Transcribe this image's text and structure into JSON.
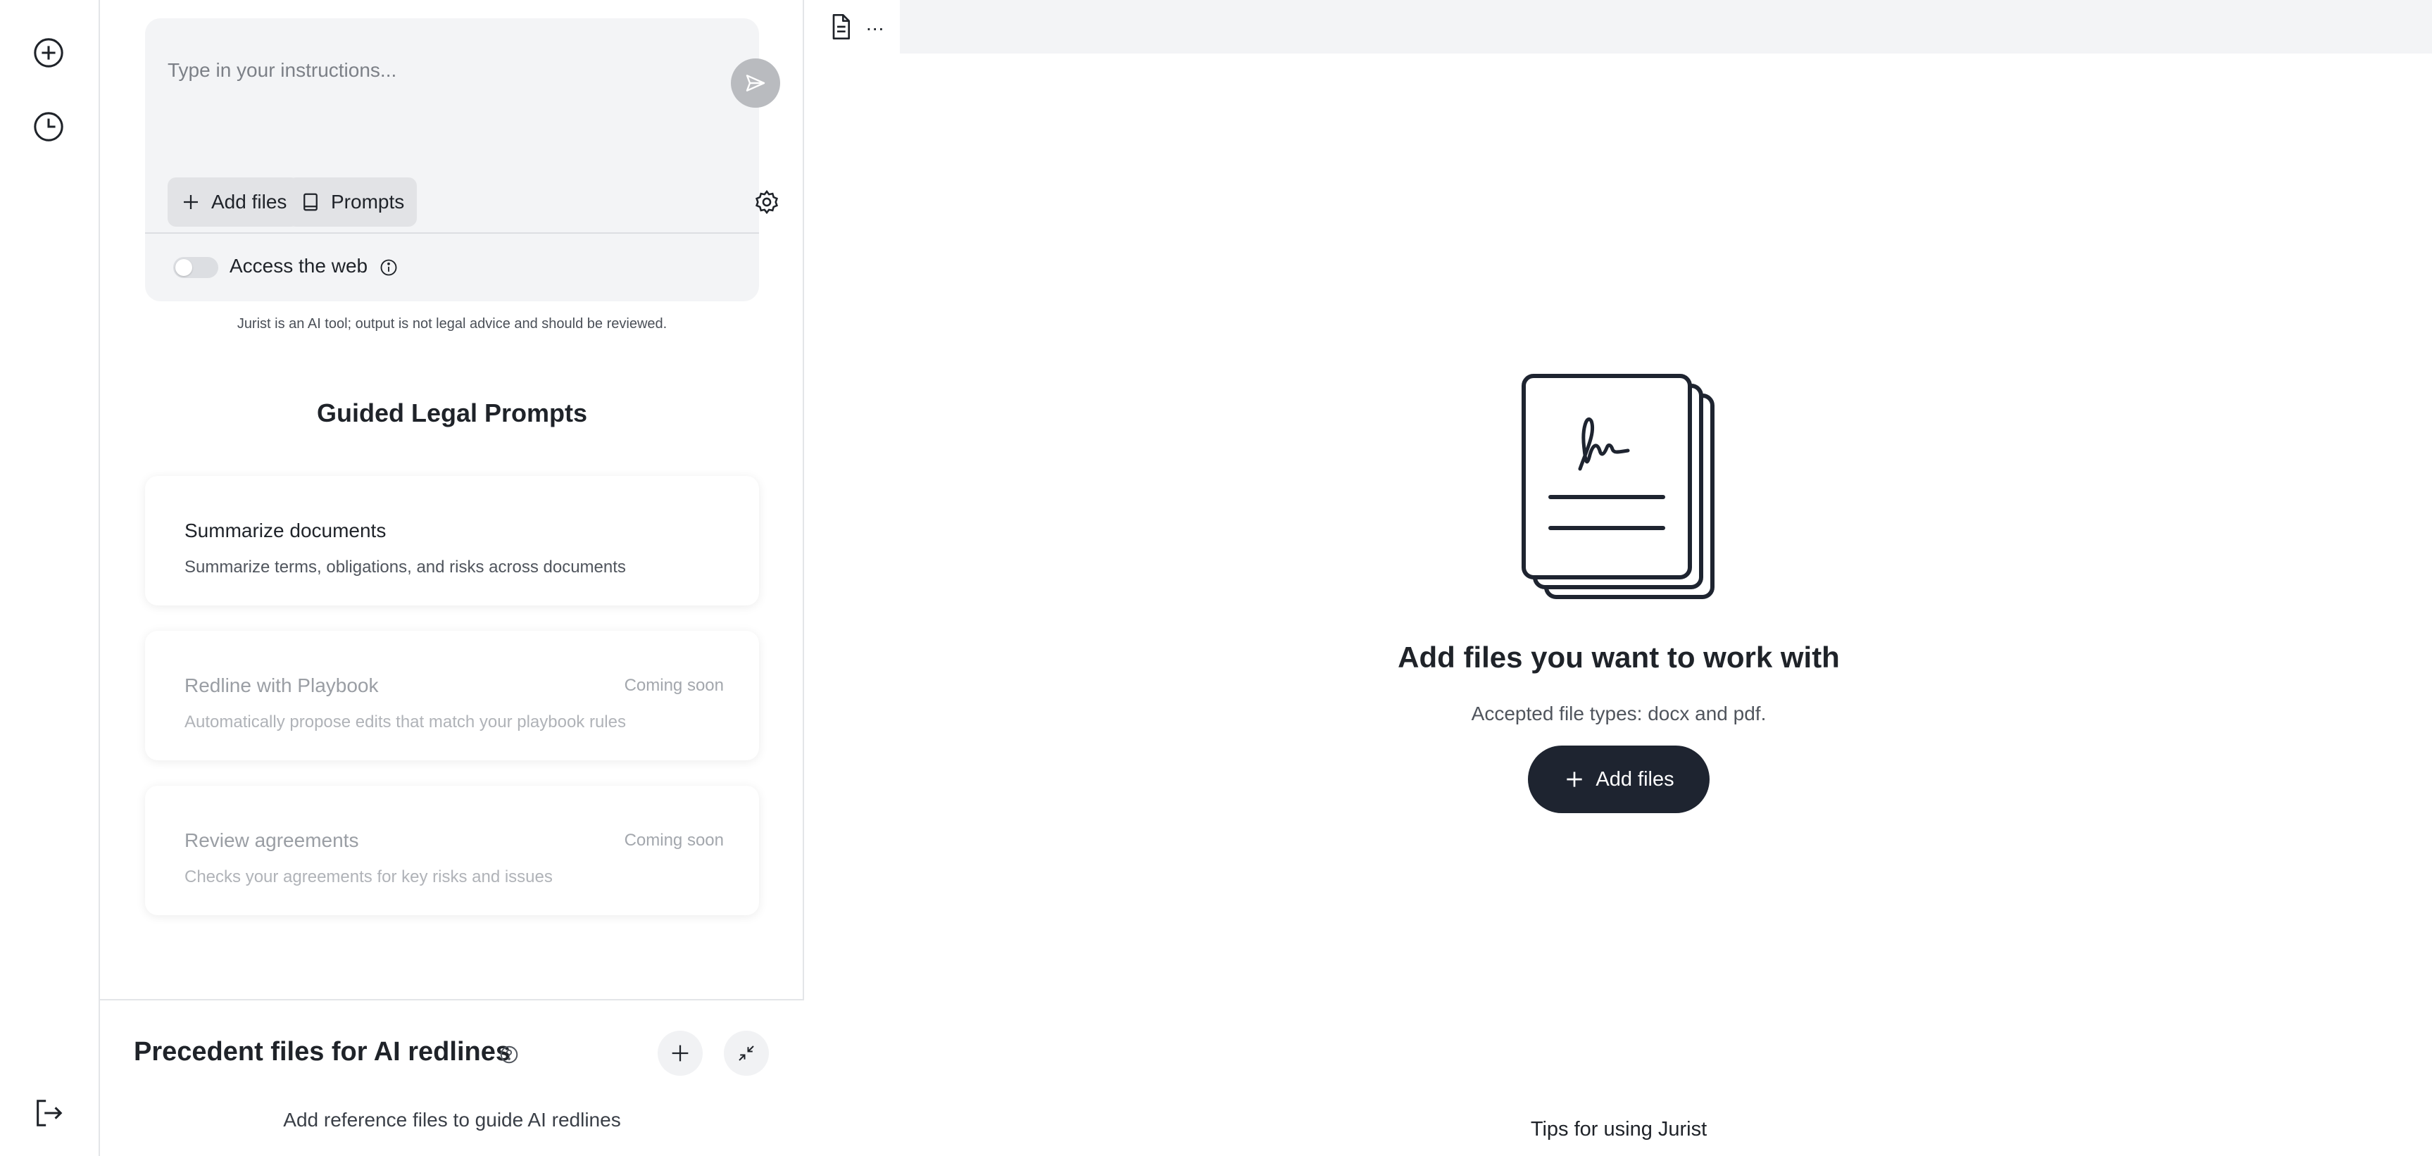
{
  "composer": {
    "placeholder": "Type in your instructions...",
    "add_files_label": "Add files",
    "prompts_label": "Prompts",
    "access_web_label": "Access the web"
  },
  "disclaimer": "Jurist is an AI tool; output is not legal advice and should be reviewed.",
  "guided": {
    "title": "Guided Legal Prompts",
    "cards": [
      {
        "title": "Summarize documents",
        "description": "Summarize terms, obligations, and risks across documents",
        "badge": ""
      },
      {
        "title": "Redline with Playbook",
        "description": "Automatically propose edits that match your playbook rules",
        "badge": "Coming soon"
      },
      {
        "title": "Review agreements",
        "description": "Checks your agreements for key risks and issues",
        "badge": "Coming soon"
      }
    ]
  },
  "precedent": {
    "title": "Precedent files for AI redlines",
    "subtitle": "Add reference files to guide AI redlines"
  },
  "viewer": {
    "tab_dots": "...",
    "empty_title": "Add files you want to work with",
    "empty_subtitle": "Accepted file types: docx and pdf.",
    "add_files_label": "Add files",
    "tips_label": "Tips for using Jurist"
  },
  "colors": {
    "primary_button": "#1e2430",
    "panel_bg": "#f3f4f6",
    "send_button_disabled": "#b9bbbf"
  },
  "icons": [
    "new-chat-icon",
    "history-icon",
    "logout-icon",
    "send-icon",
    "plus-icon",
    "book-icon",
    "gear-icon",
    "info-icon",
    "help-icon",
    "collapse-icon",
    "document-icon",
    "signed-documents-illustration"
  ]
}
